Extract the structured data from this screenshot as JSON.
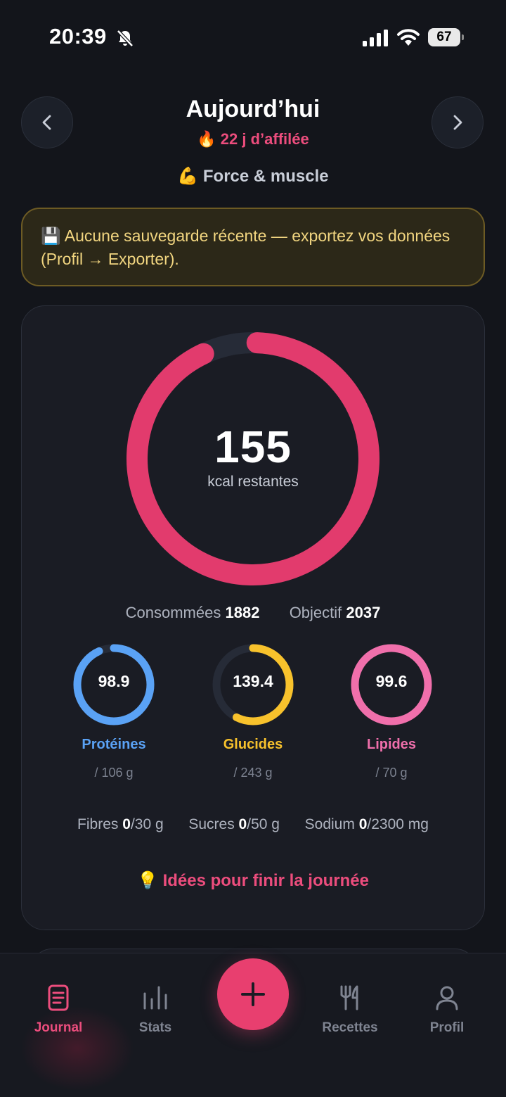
{
  "status": {
    "time": "20:39",
    "battery": "67"
  },
  "header": {
    "title": "Aujourd’hui",
    "streak": "🔥 22 j d’affilée",
    "goal": "💪 Force & muscle"
  },
  "banner": {
    "text": "💾 Aucune sauvegarde récente — exportez vos données (Profil → Exporter)."
  },
  "calories": {
    "remaining": "155",
    "remaining_label": "kcal restantes",
    "consumed_label": "Consommées",
    "consumed": "1882",
    "target_label": "Objectif",
    "target": "2037",
    "progress": 0.924,
    "color": "#e23b6d"
  },
  "macros": [
    {
      "value": "98.9",
      "name": "Protéines",
      "target": "/ 106 g",
      "progress": 0.933,
      "color": "#5aa2f5"
    },
    {
      "value": "139.4",
      "name": "Glucides",
      "target": "/ 243 g",
      "progress": 0.574,
      "color": "#f8c22c"
    },
    {
      "value": "99.6",
      "name": "Lipides",
      "target": "/ 70 g",
      "progress": 1.0,
      "color": "#f06fab"
    }
  ],
  "micros": [
    {
      "label": "Fibres",
      "value": "0",
      "target": "/30 g"
    },
    {
      "label": "Sucres",
      "value": "0",
      "target": "/50 g"
    },
    {
      "label": "Sodium",
      "value": "0",
      "target": "/2300 mg"
    }
  ],
  "ideas": {
    "text": "💡 Idées pour finir la journée"
  },
  "tabs": [
    {
      "label": "Journal",
      "icon": "journal-icon",
      "active": true
    },
    {
      "label": "Stats",
      "icon": "stats-icon",
      "active": false
    },
    {
      "label": "Recettes",
      "icon": "fork-knife-icon",
      "active": false
    },
    {
      "label": "Profil",
      "icon": "person-icon",
      "active": false
    }
  ],
  "fab": {
    "icon": "plus-icon"
  }
}
